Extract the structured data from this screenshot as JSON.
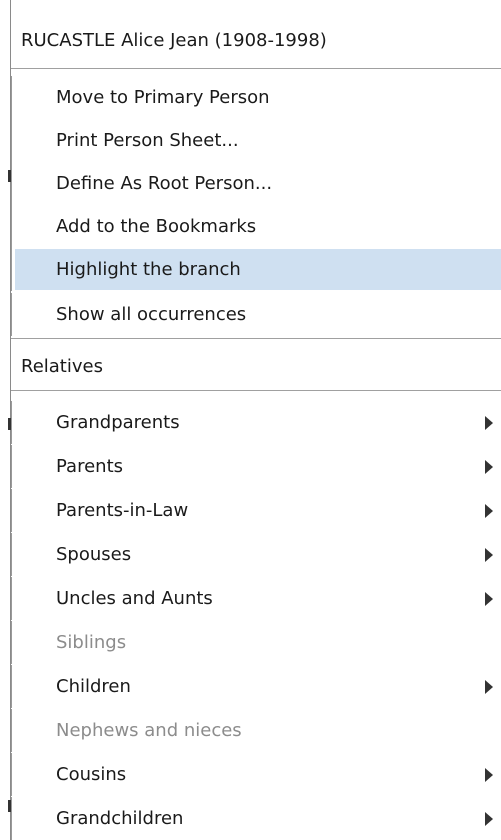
{
  "header": {
    "title": "RUCASTLE Alice Jean (1908-1998)"
  },
  "actions": [
    {
      "label": "Move to Primary Person"
    },
    {
      "label": "Print Person Sheet..."
    },
    {
      "label": "Define As Root Person..."
    },
    {
      "label": "Add to the Bookmarks"
    },
    {
      "label": "Highlight the branch",
      "highlighted": true
    },
    {
      "label": "Show all occurrences"
    }
  ],
  "relatives_section": {
    "title": "Relatives",
    "items": [
      {
        "label": "Grandparents",
        "submenu": true,
        "enabled": true
      },
      {
        "label": "Parents",
        "submenu": true,
        "enabled": true
      },
      {
        "label": "Parents-in-Law",
        "submenu": true,
        "enabled": true
      },
      {
        "label": "Spouses",
        "submenu": true,
        "enabled": true
      },
      {
        "label": "Uncles and Aunts",
        "submenu": true,
        "enabled": true
      },
      {
        "label": "Siblings",
        "submenu": false,
        "enabled": false
      },
      {
        "label": "Children",
        "submenu": true,
        "enabled": true
      },
      {
        "label": "Nephews and nieces",
        "submenu": false,
        "enabled": false
      },
      {
        "label": "Cousins",
        "submenu": true,
        "enabled": true
      },
      {
        "label": "Grandchildren",
        "submenu": true,
        "enabled": true
      }
    ]
  },
  "colors": {
    "highlight": "#cfe0f1",
    "disabled_text": "#8c8c8c",
    "separator": "#a0a0a0"
  }
}
